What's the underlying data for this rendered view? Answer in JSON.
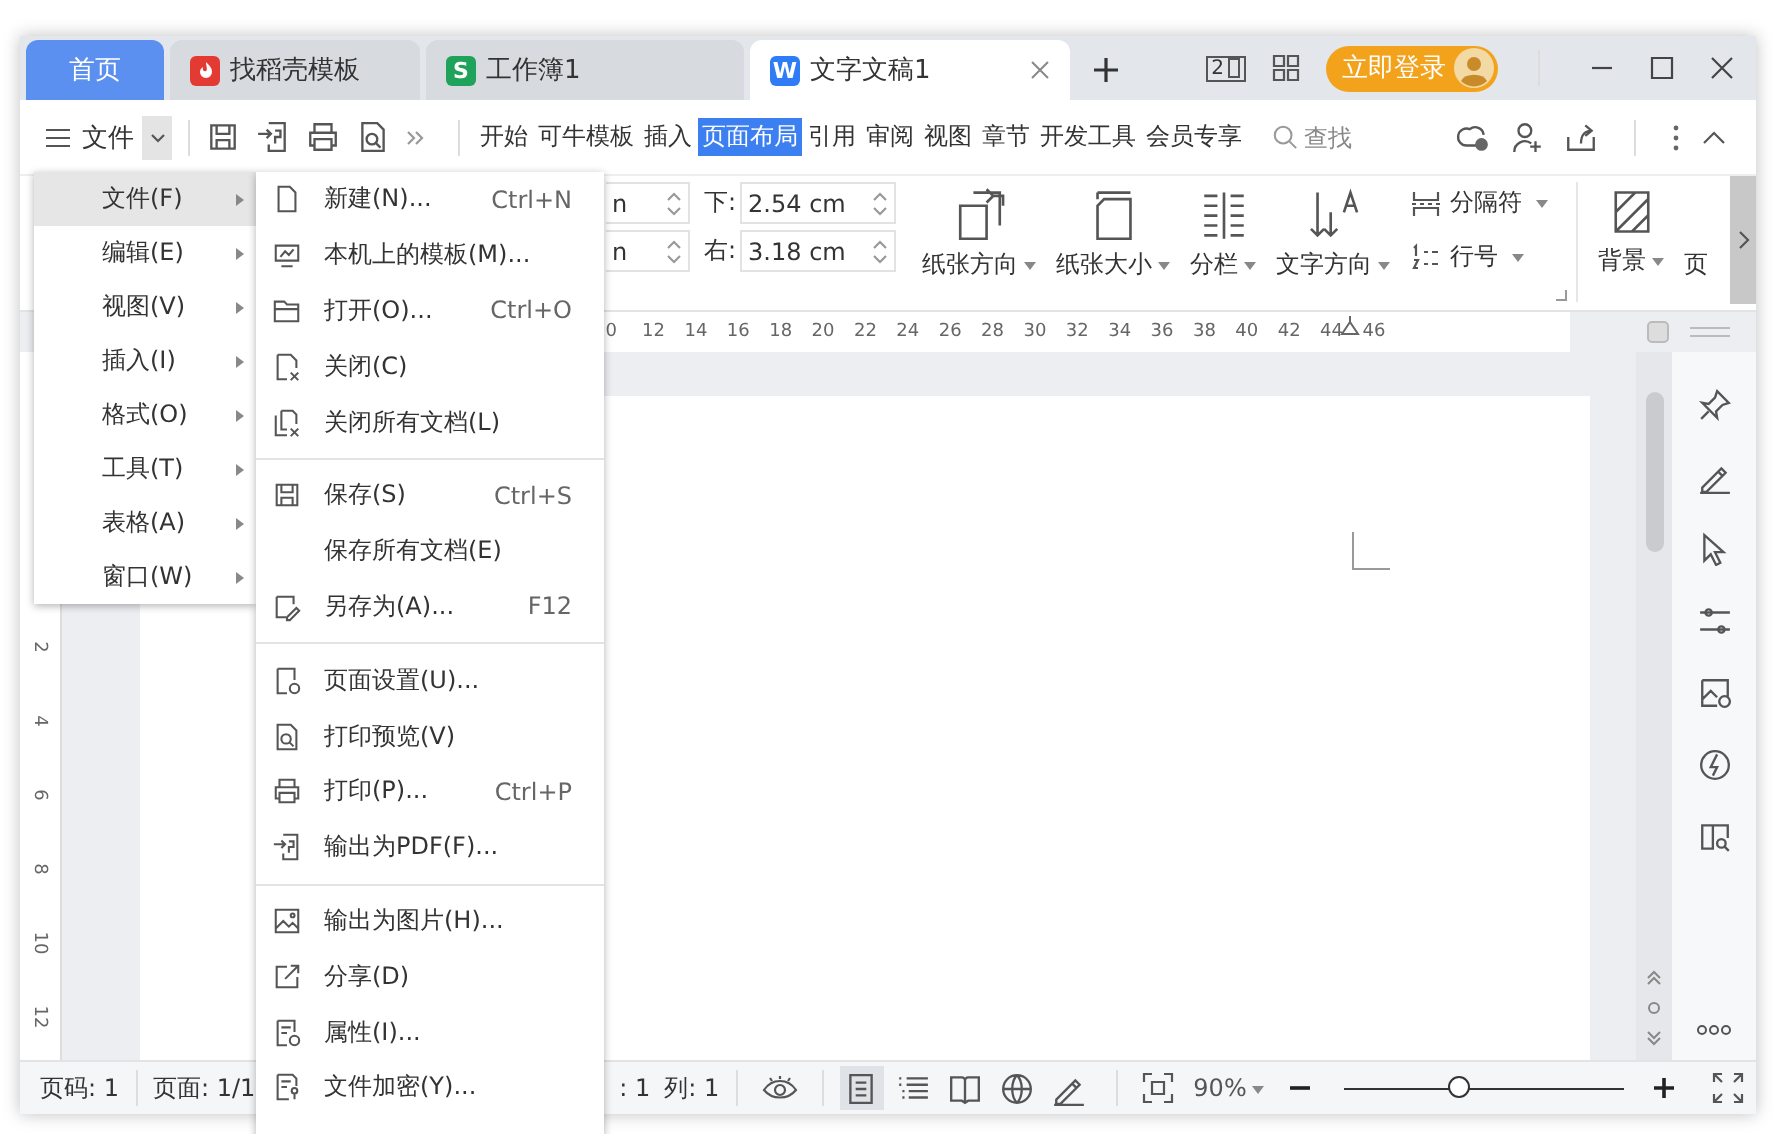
{
  "tabs": [
    {
      "label": "首页",
      "kind": "home",
      "selected": false
    },
    {
      "label": "找稻壳模板",
      "kind": "docer",
      "selected": false
    },
    {
      "label": "工作簿1",
      "kind": "sheet",
      "logo": "S",
      "selected": false
    },
    {
      "label": "文字文稿1",
      "kind": "writer",
      "logo": "W",
      "selected": true
    }
  ],
  "screen_badge": "2",
  "login": "立即登录",
  "file_button": "文件",
  "ribbon_tabs": [
    {
      "label": "开始",
      "selected": false
    },
    {
      "label": "可牛模板",
      "selected": false
    },
    {
      "label": "插入",
      "selected": false
    },
    {
      "label": "页面布局",
      "selected": true
    },
    {
      "label": "引用",
      "selected": false
    },
    {
      "label": "审阅",
      "selected": false
    },
    {
      "label": "视图",
      "selected": false
    },
    {
      "label": "章节",
      "selected": false
    },
    {
      "label": "开发工具",
      "selected": false
    },
    {
      "label": "会员专享",
      "selected": false
    }
  ],
  "search": {
    "placeholder": "查找"
  },
  "ribbon": {
    "partial_fields": [
      {
        "value": "n"
      },
      {
        "value": "n"
      }
    ],
    "margin_fields": [
      {
        "label": "下:",
        "value": "2.54 cm"
      },
      {
        "label": "右:",
        "value": "3.18 cm"
      }
    ],
    "big_buttons": [
      {
        "label": "纸张方向",
        "kind": "orientation"
      },
      {
        "label": "纸张大小",
        "kind": "size"
      },
      {
        "label": "分栏",
        "kind": "columns"
      },
      {
        "label": "文字方向",
        "kind": "direction"
      }
    ],
    "small_buttons": [
      {
        "label": "分隔符",
        "kind": "break"
      },
      {
        "label": "行号",
        "kind": "line-number"
      }
    ],
    "background": "背景",
    "cut_label": "页"
  },
  "ruler": [
    "0",
    "12",
    "14",
    "16",
    "18",
    "20",
    "22",
    "24",
    "26",
    "28",
    "30",
    "32",
    "34",
    "36",
    "38",
    "40",
    "42",
    "44",
    "46"
  ],
  "vertical_ruler": [
    "2",
    "4",
    "6",
    "8",
    "10",
    "12"
  ],
  "menu": [
    {
      "label": "文件(F)",
      "selected": true
    },
    {
      "label": "编辑(E)",
      "selected": false
    },
    {
      "label": "视图(V)",
      "selected": false
    },
    {
      "label": "插入(I)",
      "selected": false
    },
    {
      "label": "格式(O)",
      "selected": false
    },
    {
      "label": "工具(T)",
      "selected": false
    },
    {
      "label": "表格(A)",
      "selected": false
    },
    {
      "label": "窗口(W)",
      "selected": false
    }
  ],
  "submenu": [
    [
      {
        "label": "新建(N)...",
        "shortcut": "Ctrl+N",
        "kind": "new"
      },
      {
        "label": "本机上的模板(M)...",
        "kind": "template"
      },
      {
        "label": "打开(O)...",
        "shortcut": "Ctrl+O",
        "kind": "open"
      },
      {
        "label": "关闭(C)",
        "kind": "close"
      },
      {
        "label": "关闭所有文档(L)",
        "kind": "close-all"
      }
    ],
    [
      {
        "label": "保存(S)",
        "shortcut": "Ctrl+S",
        "kind": "save"
      },
      {
        "label": "保存所有文档(E)",
        "kind": "none"
      },
      {
        "label": "另存为(A)...",
        "shortcut": "F12",
        "kind": "save-as"
      }
    ],
    [
      {
        "label": "页面设置(U)...",
        "kind": "page-setup"
      },
      {
        "label": "打印预览(V)",
        "kind": "preview"
      },
      {
        "label": "打印(P)...",
        "shortcut": "Ctrl+P",
        "kind": "print"
      },
      {
        "label": "输出为PDF(F)...",
        "kind": "pdf"
      }
    ],
    [
      {
        "label": "输出为图片(H)...",
        "kind": "image"
      },
      {
        "label": "分享(D)",
        "kind": "share"
      },
      {
        "label": "属性(I)...",
        "kind": "properties"
      },
      {
        "label": "文件加密(Y)...",
        "kind": "encrypt"
      }
    ]
  ],
  "status": {
    "page_number": "页码: 1",
    "pages": "页面: 1/1",
    "row": ": 1",
    "column": "列: 1",
    "zoom": "90%",
    "zoom_slider": {
      "level": 0.42
    }
  },
  "view_buttons": [
    {
      "kind": "page",
      "selected": true
    },
    {
      "kind": "outline",
      "selected": false
    },
    {
      "kind": "read",
      "selected": false
    },
    {
      "kind": "web",
      "selected": false
    },
    {
      "kind": "write",
      "selected": false
    }
  ]
}
